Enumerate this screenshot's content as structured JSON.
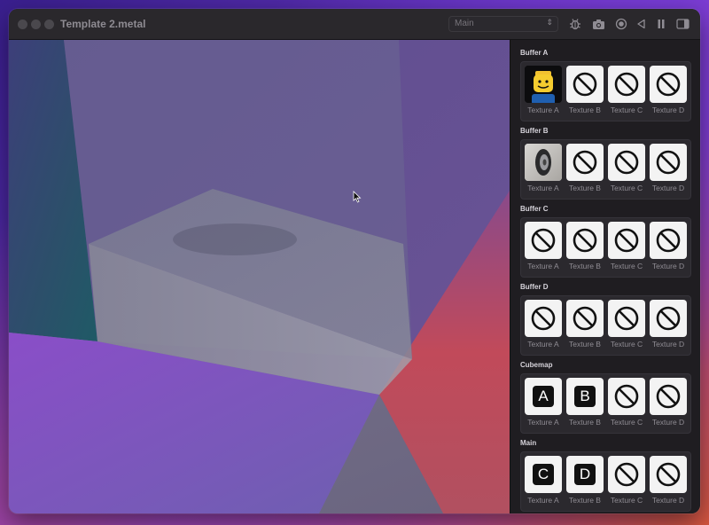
{
  "window": {
    "title": "Template 2.metal",
    "scheme_value": "Main"
  },
  "toolbar": {
    "icons": [
      "bug-icon",
      "camera-icon",
      "record-icon",
      "rewind-icon",
      "pause-icon",
      "sidebar-toggle-icon"
    ]
  },
  "sidebar": {
    "sections": [
      {
        "name": "Buffer A",
        "slots": [
          {
            "label": "Texture A",
            "content": "lego-image"
          },
          {
            "label": "Texture B",
            "content": "none"
          },
          {
            "label": "Texture C",
            "content": "none"
          },
          {
            "label": "Texture D",
            "content": "none"
          }
        ]
      },
      {
        "name": "Buffer B",
        "slots": [
          {
            "label": "Texture A",
            "content": "wheel-image"
          },
          {
            "label": "Texture B",
            "content": "none"
          },
          {
            "label": "Texture C",
            "content": "none"
          },
          {
            "label": "Texture D",
            "content": "none"
          }
        ]
      },
      {
        "name": "Buffer C",
        "slots": [
          {
            "label": "Texture A",
            "content": "none"
          },
          {
            "label": "Texture B",
            "content": "none"
          },
          {
            "label": "Texture C",
            "content": "none"
          },
          {
            "label": "Texture D",
            "content": "none"
          }
        ]
      },
      {
        "name": "Buffer D",
        "slots": [
          {
            "label": "Texture A",
            "content": "none"
          },
          {
            "label": "Texture B",
            "content": "none"
          },
          {
            "label": "Texture C",
            "content": "none"
          },
          {
            "label": "Texture D",
            "content": "none"
          }
        ]
      },
      {
        "name": "Cubemap",
        "slots": [
          {
            "label": "Texture A",
            "content": "letter",
            "letter": "A"
          },
          {
            "label": "Texture B",
            "content": "letter",
            "letter": "B"
          },
          {
            "label": "Texture C",
            "content": "none"
          },
          {
            "label": "Texture D",
            "content": "none"
          }
        ]
      },
      {
        "name": "Main",
        "slots": [
          {
            "label": "Texture A",
            "content": "letter",
            "letter": "C"
          },
          {
            "label": "Texture B",
            "content": "letter",
            "letter": "D"
          },
          {
            "label": "Texture C",
            "content": "none"
          },
          {
            "label": "Texture D",
            "content": "none"
          }
        ]
      }
    ]
  }
}
